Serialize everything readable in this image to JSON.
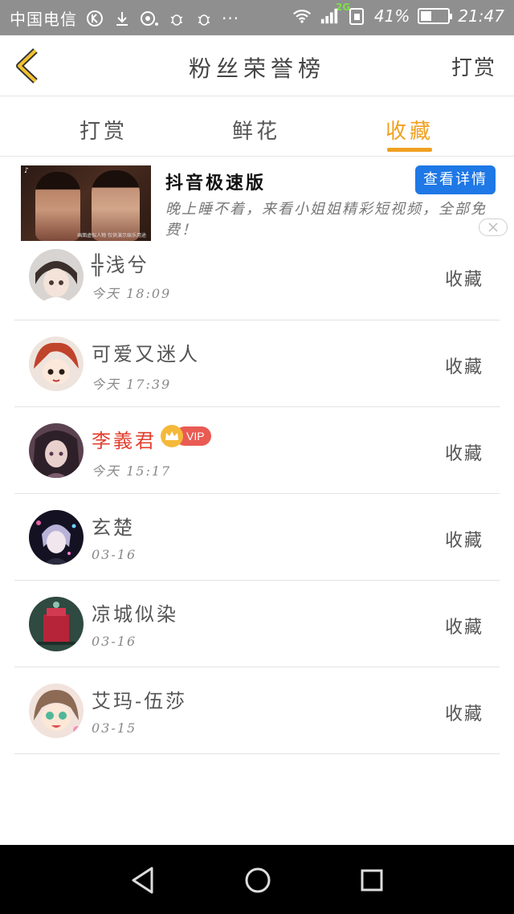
{
  "status_bar": {
    "carrier": "中国电信",
    "dots": "···",
    "network": "2G",
    "battery": "41%",
    "battery_level": 0.41,
    "time": "21:47"
  },
  "header": {
    "title": "粉丝荣誉榜",
    "action": "打赏"
  },
  "tabs": [
    {
      "label": "打赏",
      "active": false
    },
    {
      "label": "鲜花",
      "active": false
    },
    {
      "label": "收藏",
      "active": true
    }
  ],
  "ad": {
    "title": "抖音极速版",
    "button": "查看详情",
    "description": "晚上睡不着，来看小姐姐精彩短视频，全部免费！",
    "image_caption": "画面虚拟人物 仅供演示娱乐用途"
  },
  "list": [
    {
      "name": "╬浅兮",
      "time": "今天 18:09",
      "action": "收藏",
      "vip": false
    },
    {
      "name": "可爱又迷人",
      "time": "今天 17:39",
      "action": "收藏",
      "vip": false
    },
    {
      "name": "李義君",
      "time": "今天 15:17",
      "action": "收藏",
      "vip": true,
      "vip_label": "VIP"
    },
    {
      "name": "玄楚",
      "time": "03-16",
      "action": "收藏",
      "vip": false
    },
    {
      "name": "凉城似染",
      "time": "03-16",
      "action": "收藏",
      "vip": false
    },
    {
      "name": "艾玛-伍莎",
      "time": "03-15",
      "action": "收藏",
      "vip": false
    }
  ],
  "colors": {
    "accent": "#f0a020",
    "vip_name": "#e2402f",
    "ad_button": "#1e78e6",
    "status_bar": "#8f8f8f"
  },
  "icons": {
    "back": "chevron-left-icon",
    "close": "close-icon",
    "nav_back": "triangle-back-icon",
    "nav_home": "circle-home-icon",
    "nav_recent": "square-recent-icon"
  }
}
